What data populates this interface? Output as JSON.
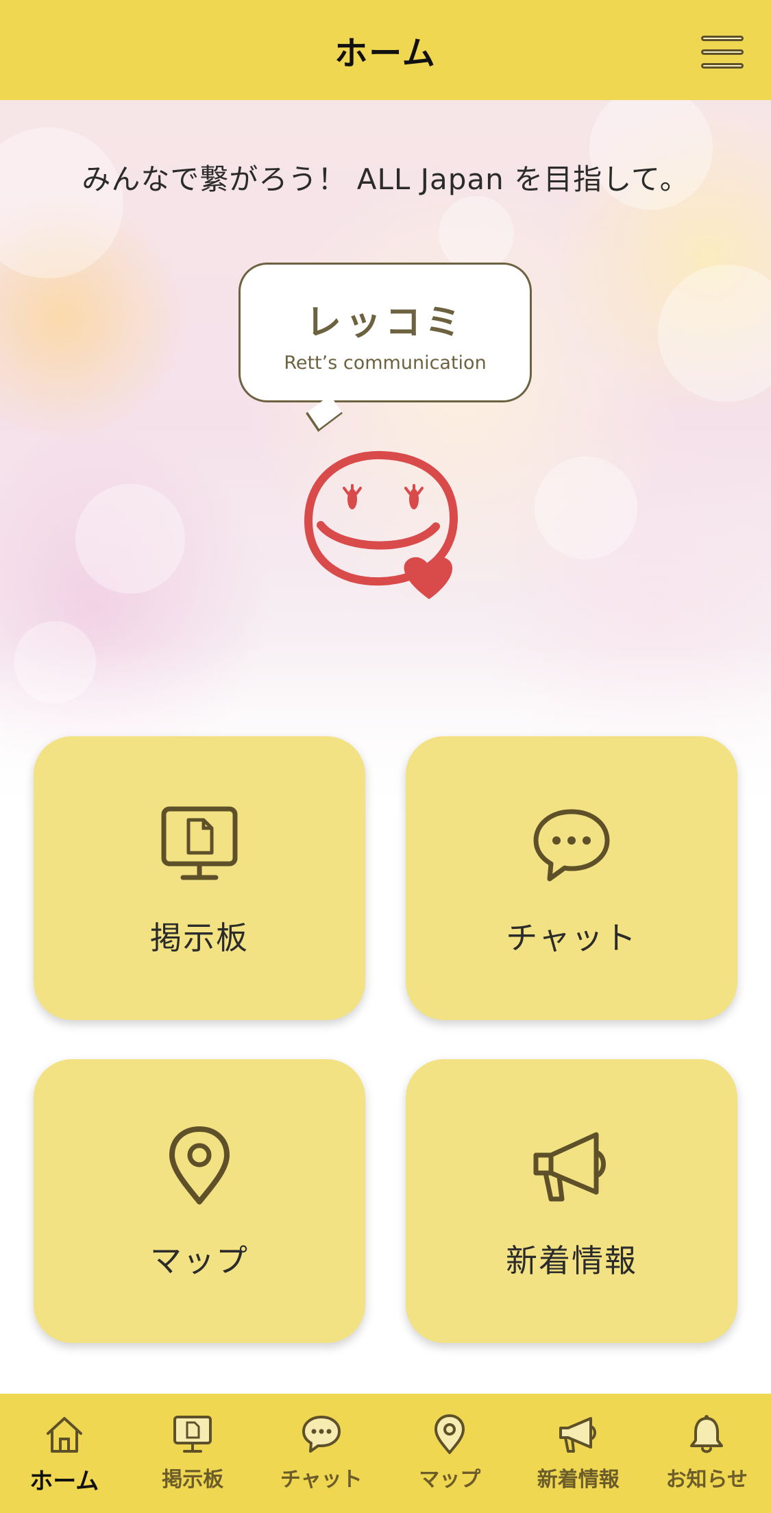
{
  "header": {
    "title": "ホーム",
    "menu_icon": "hamburger-menu-icon"
  },
  "hero": {
    "tagline": "みんなで繋がろう！ ALL Japan を目指して。",
    "bubble_title": "レッコミ",
    "bubble_subtitle": "Rett’s communication",
    "mascot_icon": "smiley-heart-icon"
  },
  "tiles": [
    {
      "label": "掲示板",
      "icon": "bulletin-board-icon"
    },
    {
      "label": "チャット",
      "icon": "chat-bubble-icon"
    },
    {
      "label": "マップ",
      "icon": "map-pin-icon"
    },
    {
      "label": "新着情報",
      "icon": "megaphone-icon"
    }
  ],
  "tabbar": {
    "items": [
      {
        "label": "ホーム",
        "icon": "home-icon",
        "active": true
      },
      {
        "label": "掲示板",
        "icon": "bulletin-board-icon",
        "active": false
      },
      {
        "label": "チャット",
        "icon": "chat-bubble-icon",
        "active": false
      },
      {
        "label": "マップ",
        "icon": "map-pin-icon",
        "active": false
      },
      {
        "label": "新着情報",
        "icon": "megaphone-icon",
        "active": false
      },
      {
        "label": "お知らせ",
        "icon": "bell-icon",
        "active": false
      }
    ]
  },
  "colors": {
    "accent": "#efd752",
    "tile": "#f2e283",
    "icon_stroke": "#5e512a",
    "mascot_red": "#d94a4a"
  }
}
